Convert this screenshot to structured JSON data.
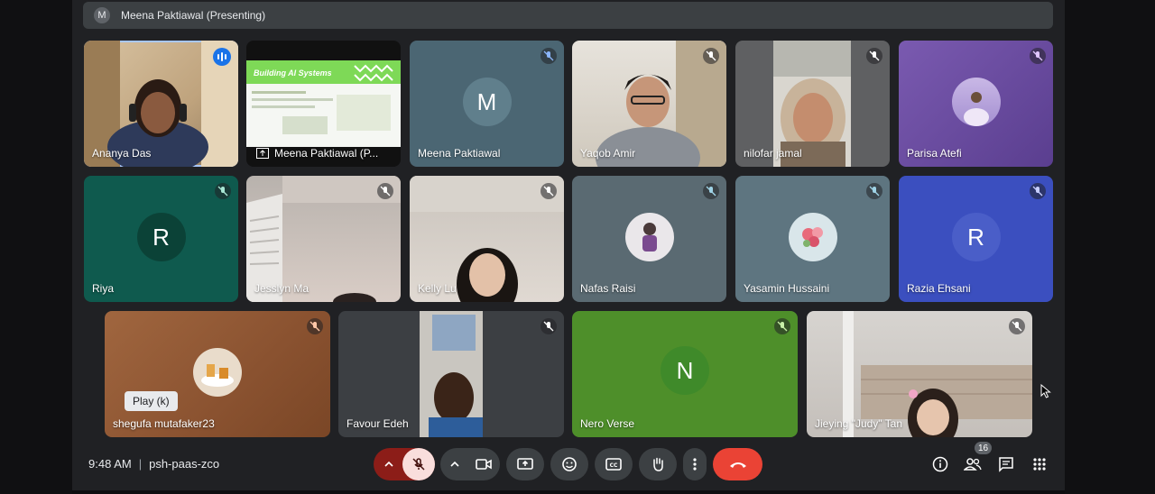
{
  "presenter_bar": {
    "initial": "M",
    "text": "Meena Paktiawal (Presenting)"
  },
  "tiles_row1": [
    {
      "name": "Ananya Das"
    },
    {
      "name": "Meena Paktiawal (P...",
      "slide_title": "Building AI Systems"
    },
    {
      "name": "Meena Paktiawal",
      "initial": "M"
    },
    {
      "name": "Yaqob Amir"
    },
    {
      "name": "nilofar jamal"
    },
    {
      "name": "Parisa Atefi"
    }
  ],
  "tiles_row2": [
    {
      "name": "Riya",
      "initial": "R"
    },
    {
      "name": "Jesslyn Ma"
    },
    {
      "name": "Kelly Lu"
    },
    {
      "name": "Nafas Raisi"
    },
    {
      "name": "Yasamin Hussaini"
    },
    {
      "name": "Razia Ehsani",
      "initial": "R"
    }
  ],
  "tiles_row3": [
    {
      "name": "shegufa mutafaker23"
    },
    {
      "name": "Favour Edeh"
    },
    {
      "name": "Nero Verse",
      "initial": "N"
    },
    {
      "name": "Jieying \"Judy\" Tan"
    }
  ],
  "tooltip": "Play (k)",
  "meeting": {
    "time": "9:48 AM",
    "separator": "|",
    "code": "psh-paas-zco"
  },
  "participants_count": "16",
  "colors": {
    "riya_tile": "#0f5a4e",
    "riya_avatar": "#0b4237",
    "razia_tile": "#3b4fbf",
    "razia_avatar": "#4a5ec8",
    "nero_tile": "#4e8f2a",
    "nero_avatar": "#3f8a2a",
    "meena_tile": "#4b6673",
    "meena_avatar": "#607f8c",
    "end_call": "#ea4335"
  }
}
